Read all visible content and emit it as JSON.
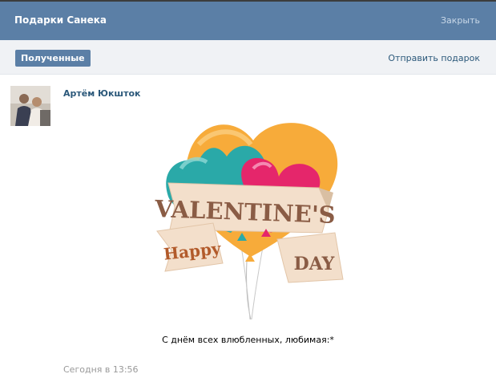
{
  "header": {
    "title": "Подарки Санека",
    "close_label": "Закрыть"
  },
  "toolbar": {
    "active_tab": "Полученные",
    "send_gift_label": "Отправить подарок"
  },
  "gift_item": {
    "author_name": "Артём Юкшток",
    "gift_image": {
      "banner_text": "VALENTINE'S",
      "left_ribbon_text": "Happy",
      "right_ribbon_text": "DAY"
    },
    "message": "С днём всех влюбленных, любимая:*",
    "timestamp": "Сегодня в 13:56"
  },
  "colors": {
    "header_bg": "#5b7fa6",
    "link": "#2b587a",
    "muted": "#999999"
  }
}
